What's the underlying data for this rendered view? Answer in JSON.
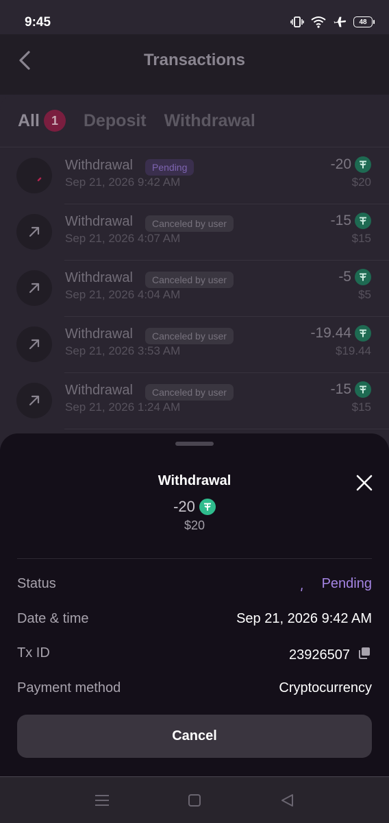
{
  "status_bar": {
    "time": "9:45",
    "battery": "48"
  },
  "header": {
    "title": "Transactions"
  },
  "tabs": [
    {
      "label": "All",
      "badge": "1"
    },
    {
      "label": "Deposit"
    },
    {
      "label": "Withdrawal"
    }
  ],
  "transactions": [
    {
      "type": "Withdrawal",
      "status": "Pending",
      "date": "Sep 21, 2026 9:42 AM",
      "amount": "-20",
      "usd": "$20"
    },
    {
      "type": "Withdrawal",
      "status": "Canceled by user",
      "date": "Sep 21, 2026 4:07 AM",
      "amount": "-15",
      "usd": "$15"
    },
    {
      "type": "Withdrawal",
      "status": "Canceled by user",
      "date": "Sep 21, 2026 4:04 AM",
      "amount": "-5",
      "usd": "$5"
    },
    {
      "type": "Withdrawal",
      "status": "Canceled by user",
      "date": "Sep 21, 2026 3:53 AM",
      "amount": "-19.44",
      "usd": "$19.44"
    },
    {
      "type": "Withdrawal",
      "status": "Canceled by user",
      "date": "Sep 21, 2026 1:24 AM",
      "amount": "-15",
      "usd": "$15"
    }
  ],
  "sheet": {
    "title": "Withdrawal",
    "amount": "-20",
    "usd": "$20",
    "details": [
      {
        "label": "Status",
        "value": "Pending"
      },
      {
        "label": "Date & time",
        "value": "Sep 21, 2026 9:42 AM"
      },
      {
        "label": "Tx ID",
        "value": "23926507"
      },
      {
        "label": "Payment method",
        "value": "Cryptocurrency"
      }
    ],
    "cancel_label": "Cancel"
  },
  "colors": {
    "pending": "#a585e4",
    "tether": "#2fbc8d",
    "badge": "#7a1e3f"
  },
  "icons": {
    "back": "chevron-left-icon",
    "close": "close-icon",
    "tether": "tether-icon",
    "copy": "copy-icon",
    "withdrawal": "arrow-up-right-icon"
  }
}
